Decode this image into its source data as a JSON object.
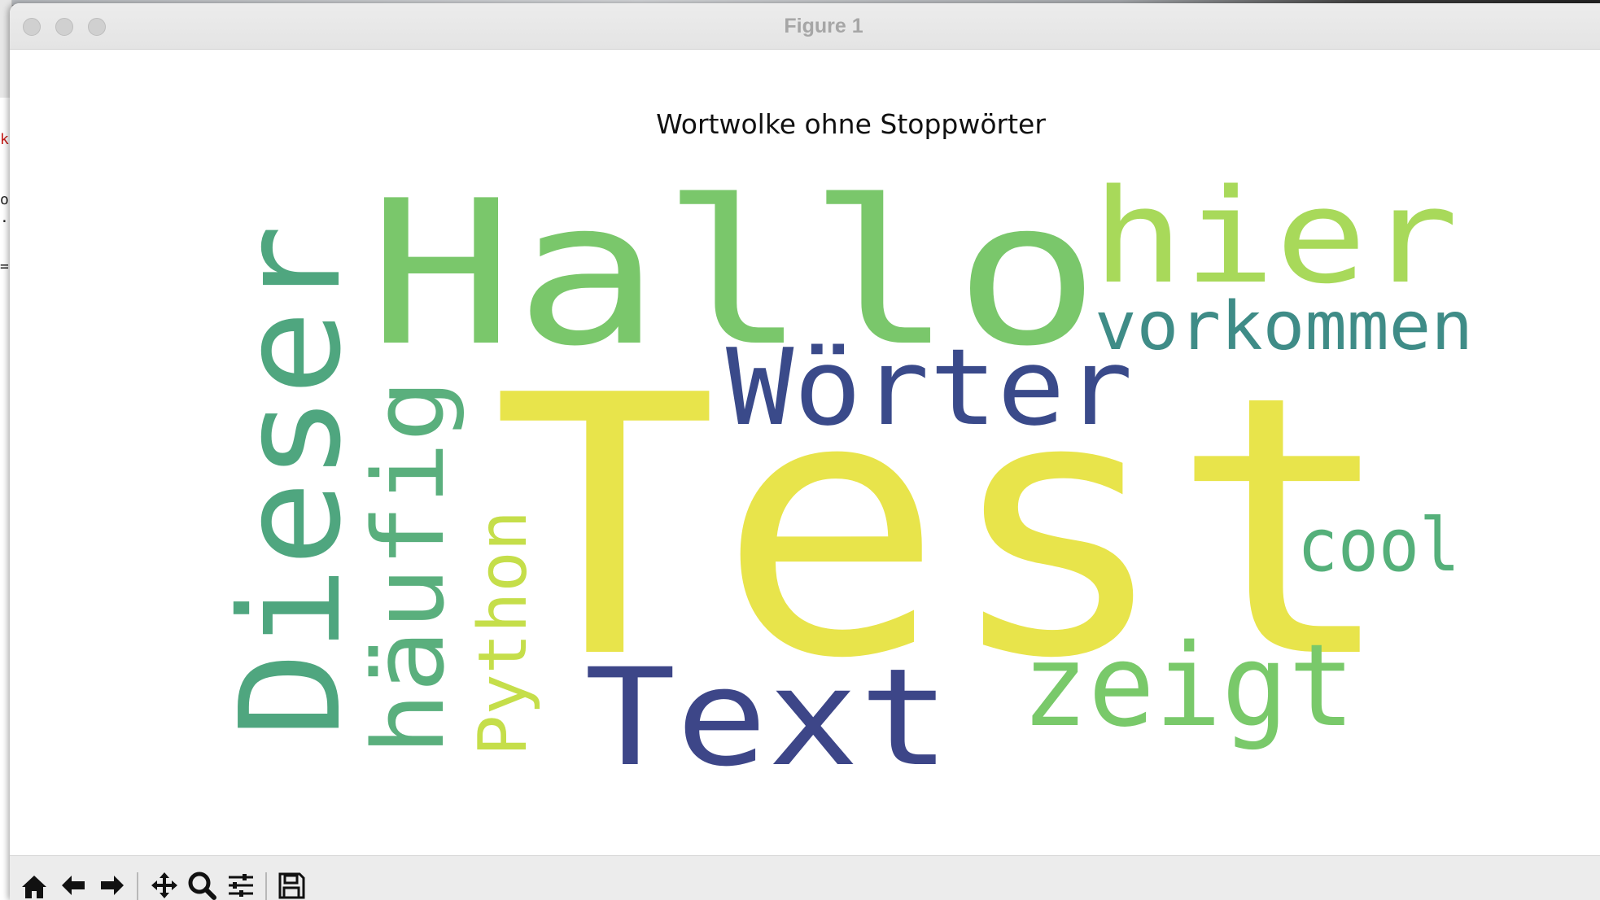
{
  "window": {
    "title": "Figure 1"
  },
  "background_editor": {
    "fragments": [
      "ke",
      "o",
      ".",
      "="
    ]
  },
  "figure": {
    "title": "Wortwolke ohne Stoppwörter"
  },
  "wordcloud": {
    "colormap": "viridis",
    "words": [
      {
        "text": "Test",
        "color": "#e8e44b",
        "orientation": "horizontal"
      },
      {
        "text": "Hallo",
        "color": "#7ac76b",
        "orientation": "horizontal"
      },
      {
        "text": "Dieser",
        "color": "#4fa67f",
        "orientation": "vertical"
      },
      {
        "text": "hier",
        "color": "#a8d95a",
        "orientation": "horizontal"
      },
      {
        "text": "Wörter",
        "color": "#3a4a8a",
        "orientation": "horizontal"
      },
      {
        "text": "vorkommen",
        "color": "#3f8c87",
        "orientation": "horizontal"
      },
      {
        "text": "häufig",
        "color": "#5aaf7d",
        "orientation": "vertical"
      },
      {
        "text": "Python",
        "color": "#c5de4a",
        "orientation": "vertical"
      },
      {
        "text": "Text",
        "color": "#3d4688",
        "orientation": "horizontal"
      },
      {
        "text": "zeigt",
        "color": "#79c96a",
        "orientation": "horizontal"
      },
      {
        "text": "cool",
        "color": "#55b07a",
        "orientation": "horizontal"
      }
    ]
  },
  "toolbar": {
    "tools": [
      "home-icon",
      "back-arrow-icon",
      "forward-arrow-icon",
      "pan-icon",
      "zoom-icon",
      "configure-subplots-icon",
      "save-icon"
    ]
  },
  "colors": {
    "titlebar": "#e6e6e6",
    "title_text": "#a6a6a6",
    "toolbar": "#ececec",
    "figure_bg": "#ffffff"
  }
}
